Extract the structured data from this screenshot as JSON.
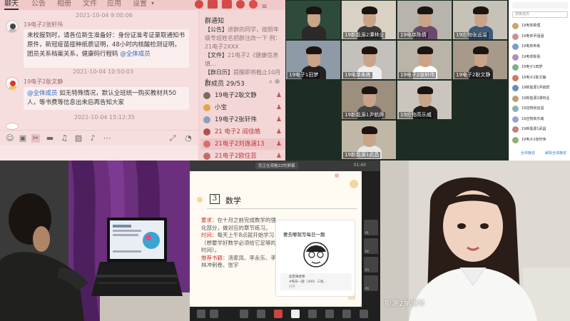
{
  "chat": {
    "tabs": [
      "聊天",
      "公告",
      "相册",
      "文件",
      "应用",
      "设置"
    ],
    "messages": [
      {
        "sender": "19电子2张轩伟",
        "time": "2021-10-04 9:00:06",
        "text": "来校报到时，请各位新生准备好：身份证准考证录取通知书原件，新冠疫苗接种纸质证明，48小时内核酸检测证明，团员关系档案关系，健康码行程码",
        "mention": "@全体成员"
      },
      {
        "sender": "19电子2耿文静",
        "time": "2021-10-04 10:50:03",
        "mention": "@全体成员",
        "text": "如无特殊情况，默认全班统一购买教材共50人，等书费等信息出来后再告知大家"
      }
    ],
    "last_time": "2021-10-04 15:12:35",
    "sidebar": {
      "notice_title": "群通知",
      "notice_lines": [
        {
          "tag": "【公告】",
          "text": "进群的同学，按照年级专班姓名把群注改一下 例：21电子2XXX"
        },
        {
          "tag": "【文件】",
          "text": "21电子2《健康信息填..."
        },
        {
          "tag": "【群日历】",
          "text": "提醒即将截止10月4..."
        }
      ],
      "member_title": "群成员 29/53",
      "members": [
        {
          "name": "19电子2耿文静",
          "color": "#7b6a5a",
          "name_color": "#333333",
          "selected": false
        },
        {
          "name": "小宝",
          "color": "#e0a64a",
          "name_color": "#333333",
          "selected": false
        },
        {
          "name": "19电子2张轩伟",
          "color": "#8aa0c0",
          "name_color": "#333333",
          "selected": false
        },
        {
          "name": "21 电子2 阎佳皓",
          "color": "#b05050",
          "name_color": "#c03535",
          "selected": false
        },
        {
          "name": "21电子2刘逸涵13",
          "color": "#d07070",
          "name_color": "#c03535",
          "selected": true
        },
        {
          "name": "21电子2欧住芸",
          "color": "#c96a6a",
          "name_color": "#c03535",
          "selected": false
        }
      ]
    }
  },
  "video_grid": {
    "tiles": [
      {
        "label": "",
        "wall": "#2e4a3a",
        "shirt": "#2a2a2a"
      },
      {
        "label": "19新能源2谭林业",
        "wall": "#d9d2c4",
        "shirt": "#3a3a3a"
      },
      {
        "label": "19电单陈倩",
        "wall": "#b7b3ad",
        "shirt": "#6a4a6a"
      },
      {
        "label": "19应物张远溢",
        "wall": "#c7c2b8",
        "shirt": "#3d5a7a"
      },
      {
        "label": "19电子1田梦",
        "wall": "#8e9aa6",
        "shirt": "#222222"
      },
      {
        "label": "19电单朱练",
        "wall": "#c4c0bb",
        "shirt": "#eeeeee"
      },
      {
        "label": "19电子2张轩伟",
        "wall": "#b9b3a8",
        "shirt": "#ffffff"
      },
      {
        "label": "19电子2耿文静",
        "wall": "#a79a8a",
        "shirt": "#2a2a2a"
      },
      {
        "label": "19新能源1尹航跸",
        "wall": "#9c8f7e",
        "shirt": "#444444"
      },
      {
        "label": "19应物高乐威",
        "wall": "#cac5bd",
        "shirt": "#202020"
      },
      {
        "label": "19新能源1武昌",
        "wall": "#c0b7a6",
        "shirt": "#e8e8e8"
      }
    ]
  },
  "participant_list": {
    "search_placeholder": "搜索成员",
    "rows": [
      {
        "name": "19电单助理",
        "color": "#c8a66b"
      },
      {
        "name": "19电单尹涵涵",
        "color": "#d09090"
      },
      {
        "name": "19电单朱练",
        "color": "#7aa0c9"
      },
      {
        "name": "19电单陈倩",
        "color": "#b48cc0"
      },
      {
        "name": "19电子1田梦",
        "color": "#7fb08a"
      },
      {
        "name": "19电子2耿文静",
        "color": "#d07a60"
      },
      {
        "name": "19新能源1尹航跸",
        "color": "#6a8ac0"
      },
      {
        "name": "19新能源2谭林业",
        "color": "#c0a070"
      },
      {
        "name": "19应物张远溢",
        "color": "#8ab0b0"
      },
      {
        "name": "19应物高乐威",
        "color": "#a0a0d0"
      },
      {
        "name": "19新能源1武昌",
        "color": "#c08080"
      },
      {
        "name": "19电子2张轩伟",
        "color": "#90b070"
      }
    ],
    "mute_all": "全体静音",
    "unmute_all": "解除全体静音"
  },
  "share": {
    "banner": "您正在观看ZZ的屏幕",
    "time": "01:40",
    "slide": {
      "number": "3",
      "title": "数学",
      "items": [
        {
          "label": "要求：",
          "text": "在十月之前完成数学的强化部分，做对应的章节练习。"
        },
        {
          "label": "时间：",
          "text": "每天上午8点就开始学习（想要学好数学必须给它足够的时间）。"
        },
        {
          "label": "推荐书籍：",
          "text": "汤家凤、李永乐、李林冲刺卷、张宇"
        }
      ],
      "mini_program": {
        "title": "要去哪就写每日一题",
        "author": "武忠祥老师",
        "caption": "#每日一题（300）三角...",
        "footer": "打开"
      }
    },
    "side_labels": [
      "P1",
      "P2",
      "P3",
      "P4"
    ]
  },
  "speaker": {
    "name": "能源2单雨琴"
  }
}
